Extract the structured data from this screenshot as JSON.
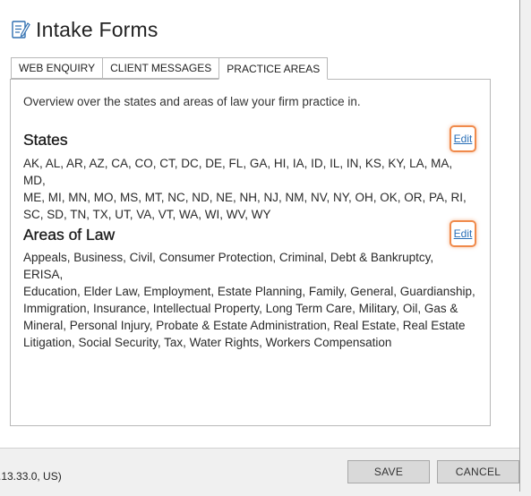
{
  "header": {
    "title": "Intake Forms",
    "icon": "form-document-icon"
  },
  "tabs": [
    {
      "label": "WEB ENQUIRY",
      "active": false
    },
    {
      "label": "CLIENT MESSAGES",
      "active": false
    },
    {
      "label": "PRACTICE AREAS",
      "active": true
    }
  ],
  "panel": {
    "overview": "Overview over the states and areas of law your firm practice in.",
    "states": {
      "title": "States",
      "edit_label": "Edit",
      "lines": [
        "AK, AL, AR, AZ, CA, CO, CT, DC, DE, FL, GA, HI, IA, ID, IL, IN, KS, KY, LA, MA, MD,",
        "ME, MI, MN, MO, MS, MT, NC, ND, NE, NH, NJ, NM, NV, NY, OH, OK, OR, PA, RI,",
        "SC, SD, TN, TX, UT, VA, VT, WA, WI, WV, WY"
      ]
    },
    "areas": {
      "title": "Areas of Law",
      "edit_label": "Edit",
      "lines": [
        "Appeals, Business, Civil, Consumer Protection, Criminal, Debt & Bankruptcy, ERISA,",
        "Education, Elder Law, Employment, Estate Planning, Family, General, Guardianship,",
        "Immigration, Insurance, Intellectual Property, Long Term Care, Military, Oil, Gas &",
        "Mineral, Personal Injury, Probate & Estate Administration, Real Estate, Real Estate",
        "Litigation, Social Security, Tax, Water Rights, Workers Compensation"
      ]
    }
  },
  "footer": {
    "version": ".13.33.0, US)",
    "save_label": "SAVE",
    "cancel_label": "CANCEL"
  },
  "colors": {
    "edit_highlight": "#f08a4b",
    "link": "#2a6fb8",
    "button_bg": "#d9d9d9"
  }
}
